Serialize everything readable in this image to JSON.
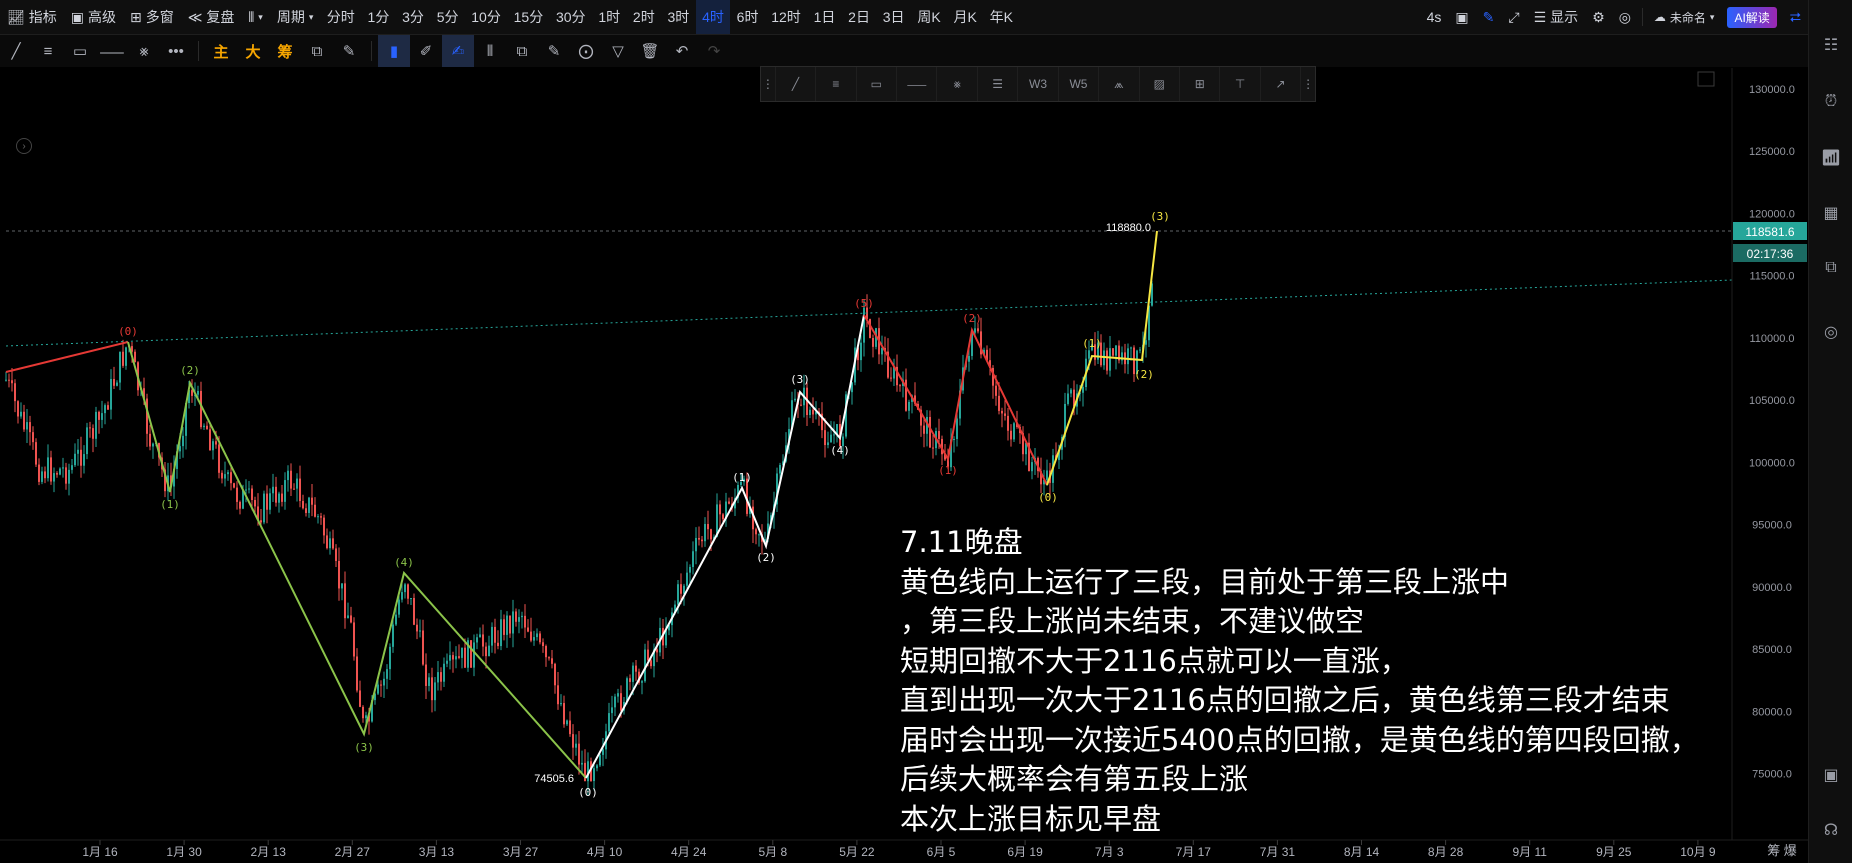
{
  "toolbar": {
    "indicators": "指标",
    "advanced": "高级",
    "multi_window": "多窗",
    "replay": "复盘",
    "period": "周期",
    "timeframes": [
      "分时",
      "1分",
      "3分",
      "5分",
      "10分",
      "15分",
      "30分",
      "1时",
      "2时",
      "3时",
      "4时",
      "6时",
      "12时",
      "1日",
      "2日",
      "3日",
      "周K",
      "月K",
      "年K"
    ],
    "active_timeframe": "4时",
    "latency": "4s",
    "display": "显示",
    "unnamed": "未命名",
    "ai_button": "AI解读"
  },
  "drawing_toolbar": {
    "text_tools": [
      "主",
      "大",
      "筹"
    ]
  },
  "price_axis": {
    "labels": [
      "130000.0",
      "125000.0",
      "120000.0",
      "115000.0",
      "110000.0",
      "105000.0",
      "100000.0",
      "95000.0",
      "90000.0",
      "85000.0",
      "80000.0",
      "75000.0"
    ],
    "current_price": "118581.6",
    "countdown": "02:17:36",
    "current_price_color": "#26a69a"
  },
  "time_axis": {
    "labels": [
      "1月 16",
      "1月 30",
      "2月 13",
      "2月 27",
      "3月 13",
      "3月 27",
      "4月 10",
      "4月 24",
      "5月 8",
      "5月 22",
      "6月 5",
      "6月 19",
      "7月 3",
      "7月 17",
      "7月 31",
      "8月 14",
      "8月 28",
      "9月 11",
      "9月 25",
      "10月 9"
    ],
    "corner": "筹 爆"
  },
  "annotations": {
    "high_price": "118880.0",
    "low_price": "74505.6"
  },
  "wave_labels": {
    "red_top_left": "(0)",
    "green": [
      "(1)",
      "(2)",
      "(3)",
      "(4)"
    ],
    "white": [
      "(0)",
      "(1)",
      "(2)",
      "(3)",
      "(4)",
      "(5)"
    ],
    "red": [
      "(1)",
      "(2)"
    ],
    "yellow": [
      "(0)",
      "(1)",
      "(2)",
      "(3)"
    ]
  },
  "note": {
    "lines": [
      "7.11晚盘",
      "黄色线向上运行了三段，目前处于第三段上涨中",
      "，第三段上涨尚未结束，不建议做空",
      "短期回撤不大于2116点就可以一直涨，",
      "直到出现一次大于2116点的回撤之后，黄色线第三段才结束",
      "届时会出现一次接近5400点的回撤，是黄色线的第四段回撤，",
      "后续大概率会有第五段上涨",
      "本次上涨目标见早盘"
    ]
  },
  "colors": {
    "accent": "#2962ff",
    "up_candle": "#26a69a",
    "down_candle": "#ef5350",
    "green_wave": "#8bc34a",
    "white_wave": "#ffffff",
    "red_wave": "#e53935",
    "yellow_wave": "#f5e642",
    "trendline": "#26a69a"
  }
}
